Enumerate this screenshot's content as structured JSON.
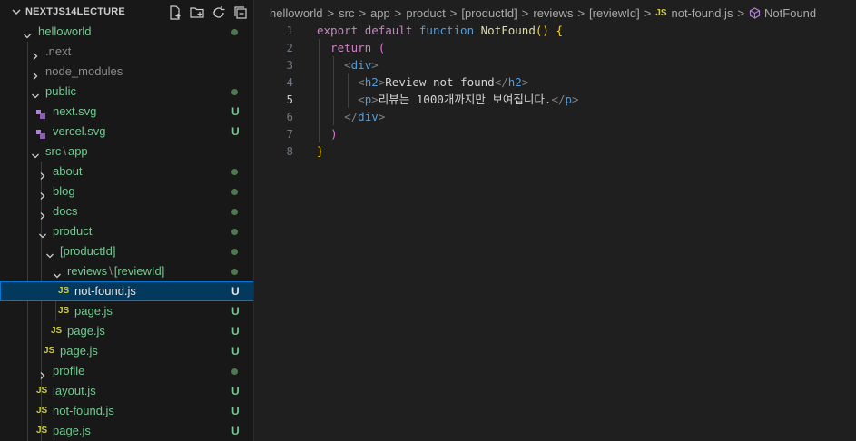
{
  "explorer": {
    "title": "NEXTJS14LECTURE",
    "actions": [
      "new-file-icon",
      "new-folder-icon",
      "refresh-icon",
      "collapse-all-icon"
    ],
    "tree": [
      {
        "label": "helloworld",
        "type": "folder",
        "open": true,
        "badge": "dot"
      },
      {
        "label": ".next",
        "type": "folder",
        "open": false,
        "badge": "",
        "dim": true
      },
      {
        "label": "node_modules",
        "type": "folder",
        "open": false,
        "badge": "",
        "dim": true
      },
      {
        "label": "public",
        "type": "folder",
        "open": true,
        "badge": "dot"
      },
      {
        "label": "next.svg",
        "type": "svg",
        "badge": "U"
      },
      {
        "label": "vercel.svg",
        "type": "svg",
        "badge": "U"
      },
      {
        "label": "src",
        "label2": "app",
        "type": "folder",
        "open": true,
        "badge": ""
      },
      {
        "label": "about",
        "type": "folder",
        "open": false,
        "badge": "dot"
      },
      {
        "label": "blog",
        "type": "folder",
        "open": false,
        "badge": "dot"
      },
      {
        "label": "docs",
        "type": "folder",
        "open": false,
        "badge": "dot"
      },
      {
        "label": "product",
        "type": "folder",
        "open": true,
        "badge": "dot"
      },
      {
        "label": "[productId]",
        "type": "folder",
        "open": true,
        "badge": "dot"
      },
      {
        "label": "reviews",
        "label2": "[reviewId]",
        "type": "folder",
        "open": true,
        "badge": "dot"
      },
      {
        "label": "not-found.js",
        "type": "js",
        "badge": "U",
        "selected": true
      },
      {
        "label": "page.js",
        "type": "js",
        "badge": "U"
      },
      {
        "label": "page.js",
        "type": "js",
        "badge": "U"
      },
      {
        "label": "page.js",
        "type": "js",
        "badge": "U"
      },
      {
        "label": "profile",
        "type": "folder",
        "open": false,
        "badge": "dot"
      },
      {
        "label": "layout.js",
        "type": "js",
        "badge": "U"
      },
      {
        "label": "not-found.js",
        "type": "js",
        "badge": "U"
      },
      {
        "label": "page.js",
        "type": "js",
        "badge": "U"
      }
    ],
    "js_icon_text": "JS"
  },
  "breadcrumb": {
    "items": [
      "helloworld",
      "src",
      "app",
      "product",
      "[productId]",
      "reviews",
      "[reviewId]"
    ],
    "file_icon": "JS",
    "file": "not-found.js",
    "symbol": "NotFound"
  },
  "editor": {
    "active_line": 5,
    "lines": [
      {
        "n": "1",
        "tokens": [
          [
            "export ",
            "k-purple"
          ],
          [
            "default ",
            "k-purple"
          ],
          [
            "function ",
            "k-blue"
          ],
          [
            "NotFound",
            "k-fn"
          ],
          [
            "() ",
            "k-paren"
          ],
          [
            "{",
            "k-paren"
          ]
        ]
      },
      {
        "n": "2",
        "tokens": [
          [
            "  return ",
            "k-purple"
          ],
          [
            "(",
            "k-paren2"
          ]
        ]
      },
      {
        "n": "3",
        "tokens": [
          [
            "    ",
            "k-text"
          ],
          [
            "<",
            "k-punc"
          ],
          [
            "div",
            "k-tag"
          ],
          [
            ">",
            "k-punc"
          ]
        ]
      },
      {
        "n": "4",
        "tokens": [
          [
            "      ",
            "k-text"
          ],
          [
            "<",
            "k-punc"
          ],
          [
            "h2",
            "k-tag"
          ],
          [
            ">",
            "k-punc"
          ],
          [
            "Review not found",
            "k-text"
          ],
          [
            "</",
            "k-punc"
          ],
          [
            "h2",
            "k-tag"
          ],
          [
            ">",
            "k-punc"
          ]
        ]
      },
      {
        "n": "5",
        "tokens": [
          [
            "      ",
            "k-text"
          ],
          [
            "<",
            "k-punc"
          ],
          [
            "p",
            "k-tag"
          ],
          [
            ">",
            "k-punc"
          ],
          [
            "리뷰는 1000개까지만 보여집니다.",
            "k-text"
          ],
          [
            "</",
            "k-punc"
          ],
          [
            "p",
            "k-tag"
          ],
          [
            ">",
            "k-punc"
          ]
        ]
      },
      {
        "n": "6",
        "tokens": [
          [
            "    ",
            "k-text"
          ],
          [
            "</",
            "k-punc"
          ],
          [
            "div",
            "k-tag"
          ],
          [
            ">",
            "k-punc"
          ]
        ]
      },
      {
        "n": "7",
        "tokens": [
          [
            "  ",
            "k-text"
          ],
          [
            ")",
            "k-paren2"
          ]
        ]
      },
      {
        "n": "8",
        "tokens": [
          [
            "}",
            "k-paren"
          ]
        ]
      }
    ]
  }
}
